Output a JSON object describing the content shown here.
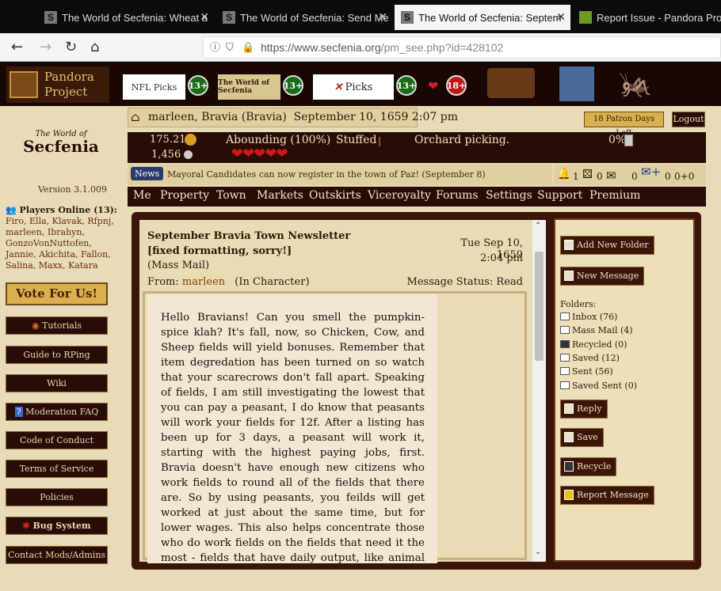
{
  "browser": {
    "tabs": [
      {
        "title": "The World of Secfenia: Wheat a",
        "icon": "S"
      },
      {
        "title": "The World of Secfenia: Send Me",
        "icon": "S"
      },
      {
        "title": "The World of Secfenia: Septem",
        "icon": "S"
      },
      {
        "title": "Report Issue - Pandora Project",
        "icon": "mantis"
      }
    ],
    "url_host": "https://www.secfenia.org",
    "url_path": "/pm_see.php?id=428102"
  },
  "header": {
    "pandora": [
      "Pandora",
      "Project"
    ],
    "ads": [
      {
        "label": "NFL Picks",
        "badge": "13+"
      },
      {
        "label": "The World of Secfenia",
        "badge": "13+"
      },
      {
        "label": "Picks",
        "badge": "13+"
      },
      {
        "label": "",
        "badge": "18+"
      }
    ]
  },
  "status": {
    "user_line": "marleen, Bravia (Bravia)  September 10, 1659 2:07 pm",
    "patron_days": "18 Patron Days Left",
    "logout": "Logout",
    "money": "175.21",
    "silver": "1,456",
    "health": "Abounding (100%)",
    "hunger": "Stuffed",
    "activity": "Orchard picking.",
    "drink": "0%",
    "news_label": "News",
    "news_text": "Mayoral Candidates can now register in the town of Paz! (September 8)",
    "counts": [
      "1",
      "0",
      "0",
      "0",
      "0+0"
    ]
  },
  "sidebar": {
    "logo_line1": "The World of",
    "logo_line2": "Secfenia",
    "version": "Version 3.1.009",
    "players_header": "Players Online (13):",
    "players": "Firo, Ella, Klavak, Rfpnj, marleen, Ibrahyn, GonzoVonNuttofen, Jannie, Akichita, Fallon, Salina, Maxx, Katara",
    "vote": "Vote For Us!",
    "buttons": [
      "Tutorials",
      "Guide to RPing",
      "Wiki",
      "Moderation FAQ",
      "Code of Conduct",
      "Terms of Service",
      "Policies",
      "Bug System",
      "Contact Mods/Admins"
    ]
  },
  "menu": [
    "Me",
    "Property",
    "Town",
    "Markets",
    "Outskirts",
    "Viceroyalty",
    "Forums",
    "Settings",
    "Support",
    "Premium"
  ],
  "message": {
    "subject": "September Bravia Town Newsletter [fixed formatting, sorry!]",
    "date": "Tue Sep 10, 1659",
    "time": "2:04 pm",
    "mass_mail": "(Mass Mail)",
    "from_label": "From:",
    "from_user": "marleen",
    "character": "(In Character)",
    "status": "Message Status: Read",
    "body": "Hello Bravians! Can you smell the pumpkin-spice klah? It's fall, now, so Chicken, Cow, and Sheep fields will yield bonuses. Remember that item degredation has been turned on so watch that your scarecrows don't fall apart. Speaking of fields, I am still investigating the lowest that you can pay a peasant, I do know that peasants will work your fields for 12f. After a listing has been up for 3 days, a peasant will work it, starting with the highest paying jobs, first. Bravia doesn't have enough new citizens who work fields to round all of the fields that there are. So by using peasants, you feilds will get worked at just about the same time, but for lower wages. This also helps concentrate those who do work fields on the fields that need it the most - fields that have daily output, like animal fields. This has been part of the season for the animal product"
  },
  "actions": {
    "add_folder": "Add New Folder",
    "new_message": "New Message",
    "folders_label": "Folders:",
    "folders": [
      "Inbox (76)",
      "Mass Mail (4)",
      "Recycled (0)",
      "Saved (12)",
      "Sent (56)",
      "Saved Sent (0)"
    ],
    "reply": "Reply",
    "save": "Save",
    "recycle": "Recycle",
    "report": "Report Message"
  }
}
